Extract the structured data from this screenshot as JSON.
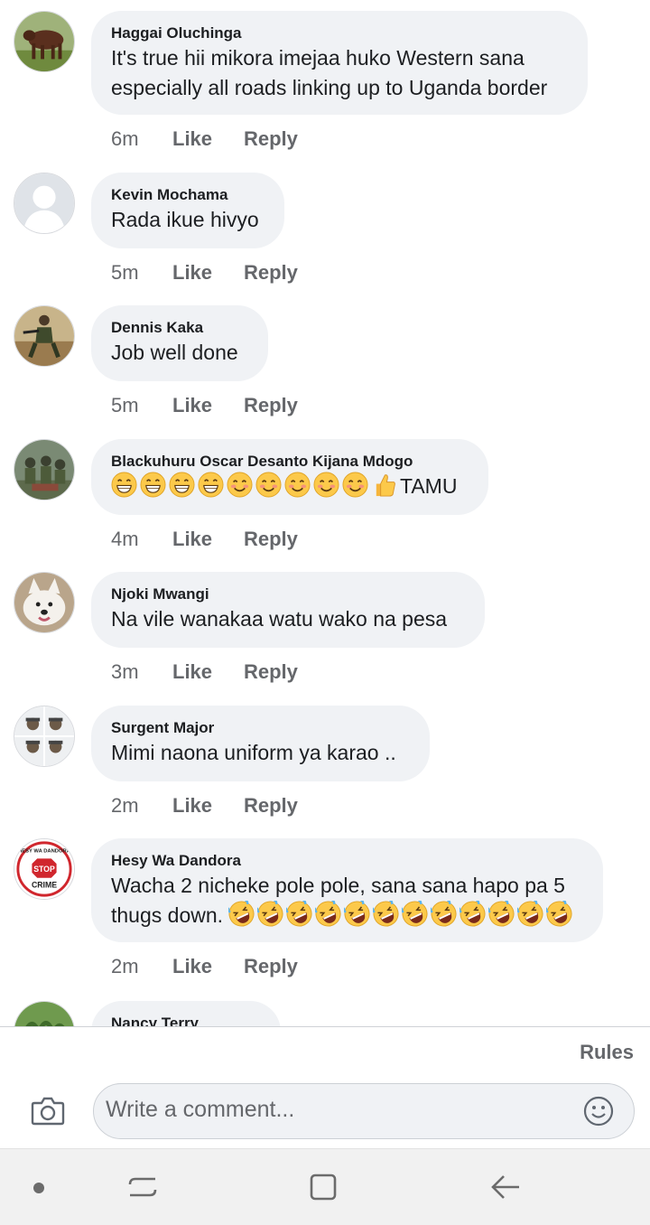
{
  "comments": [
    {
      "name": "Haggai Oluchinga",
      "text": "It's true hii mikora imejaa huko Western sana especially all roads linking up to Uganda border",
      "time": "6m",
      "like": "Like",
      "reply": "Reply"
    },
    {
      "name": "Kevin Mochama",
      "text": "Rada ikue hivyo",
      "time": "5m",
      "like": "Like",
      "reply": "Reply"
    },
    {
      "name": "Dennis Kaka",
      "text": "Job well done",
      "time": "5m",
      "like": "Like",
      "reply": "Reply"
    },
    {
      "name": "Blackuhuru Oscar Desanto Kijana Mdogo",
      "text": "TAMU",
      "emojis": [
        "grin",
        "grin",
        "grin",
        "grin",
        "smile",
        "smile",
        "smile",
        "smile",
        "smile",
        "thumbs"
      ],
      "time": "4m",
      "like": "Like",
      "reply": "Reply"
    },
    {
      "name": "Njoki Mwangi",
      "text": "Na vile wanakaa watu wako na pesa",
      "time": "3m",
      "like": "Like",
      "reply": "Reply"
    },
    {
      "name": "Surgent Major",
      "text": "Mimi naona uniform ya karao ..",
      "time": "2m",
      "like": "Like",
      "reply": "Reply"
    },
    {
      "name": "Hesy Wa Dandora",
      "text": "Wacha 2 nicheke pole pole, sana sana hapo pa 5 thugs down.",
      "emojis": [
        "laugh",
        "laugh",
        "laugh",
        "laugh",
        "laugh",
        "laugh",
        "laugh",
        "laugh",
        "laugh",
        "laugh",
        "laugh",
        "laugh"
      ],
      "time": "2m",
      "like": "Like",
      "reply": "Reply"
    },
    {
      "name": "Nancy Terry"
    }
  ],
  "avatar_logo_text": {
    "top": "HESY WA DANDORA",
    "middle": "STOP",
    "bottom": "CRIME"
  },
  "composer": {
    "rules_label": "Rules",
    "placeholder": "Write a comment...",
    "camera_icon": "camera-icon",
    "emoji_icon": "smiley-icon"
  },
  "navbar": {
    "icons": [
      "dot-icon",
      "recent-apps-icon",
      "home-icon",
      "back-icon"
    ]
  },
  "colors": {
    "bubble": "#f0f2f5",
    "meta_text": "#65676b",
    "name_text": "#1c1e21"
  }
}
